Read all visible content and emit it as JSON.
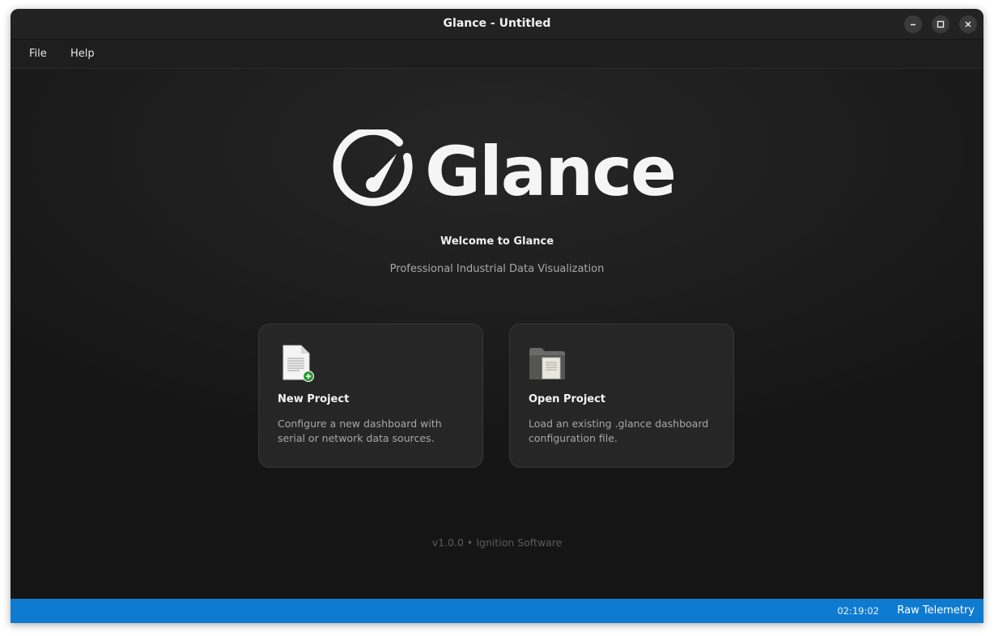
{
  "window": {
    "title": "Glance - Untitled",
    "controls": {
      "minimize_icon": "minimize-icon",
      "maximize_icon": "maximize-icon",
      "close_icon": "close-icon"
    }
  },
  "menu": {
    "items": [
      {
        "label": "File"
      },
      {
        "label": "Help"
      }
    ]
  },
  "welcome": {
    "logo_text": "Glance",
    "heading": "Welcome to Glance",
    "subtitle": "Professional Industrial Data Visualization"
  },
  "cards": [
    {
      "icon": "new-document-icon",
      "title": "New Project",
      "description": "Configure a new dashboard with serial or network data sources."
    },
    {
      "icon": "folder-icon",
      "title": "Open Project",
      "description": "Load an existing .glance dashboard configuration file."
    }
  ],
  "footer": {
    "version": "v1.0.0 • Ignition Software"
  },
  "statusbar": {
    "time": "02:19:02",
    "mode": "Raw Telemetry",
    "color": "#0f7bd0"
  },
  "colors": {
    "background": "#1a1a1a",
    "card": "#262626",
    "accent": "#0f7bd0"
  }
}
